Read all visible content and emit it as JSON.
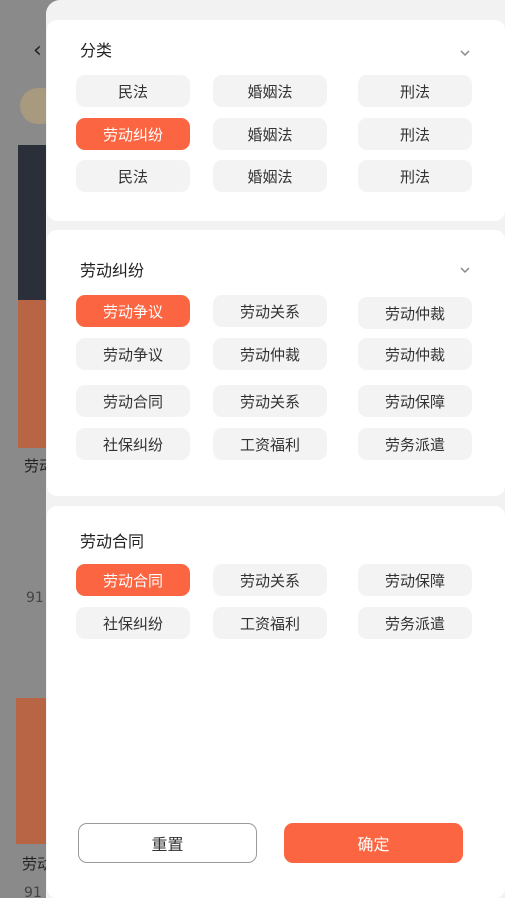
{
  "background": {
    "back_icon": "chevron-left-icon",
    "card_title_1": "劳动",
    "card_count_1": "91",
    "card_title_2": "劳动",
    "card_count_2": "91"
  },
  "colors": {
    "accent": "#fb6541",
    "chip_bg": "#f3f3f3"
  },
  "sections": [
    {
      "title": "分类",
      "chevron": "chevron-down-icon",
      "chips": [
        {
          "label": "民法",
          "active": false
        },
        {
          "label": "婚姻法",
          "active": false
        },
        {
          "label": "刑法",
          "active": false
        },
        {
          "label": "劳动纠纷",
          "active": true
        },
        {
          "label": "婚姻法",
          "active": false
        },
        {
          "label": "刑法",
          "active": false
        },
        {
          "label": "民法",
          "active": false
        },
        {
          "label": "婚姻法",
          "active": false
        },
        {
          "label": "刑法",
          "active": false
        }
      ]
    },
    {
      "title": "劳动纠纷",
      "chevron": "chevron-down-icon",
      "chips": [
        {
          "label": "劳动争议",
          "active": true
        },
        {
          "label": "劳动关系",
          "active": false
        },
        {
          "label": "劳动仲裁",
          "active": false
        },
        {
          "label": "劳动争议",
          "active": false
        },
        {
          "label": "劳动仲裁",
          "active": false
        },
        {
          "label": "劳动仲裁",
          "active": false
        },
        {
          "label": "劳动合同",
          "active": false
        },
        {
          "label": "劳动关系",
          "active": false
        },
        {
          "label": "劳动保障",
          "active": false
        },
        {
          "label": "社保纠纷",
          "active": false
        },
        {
          "label": "工资福利",
          "active": false
        },
        {
          "label": "劳务派遣",
          "active": false
        }
      ]
    },
    {
      "title": "劳动合同",
      "chips": [
        {
          "label": "劳动合同",
          "active": true
        },
        {
          "label": "劳动关系",
          "active": false
        },
        {
          "label": "劳动保障",
          "active": false
        },
        {
          "label": "社保纠纷",
          "active": false
        },
        {
          "label": "工资福利",
          "active": false
        },
        {
          "label": "劳务派遣",
          "active": false
        }
      ]
    }
  ],
  "footer": {
    "reset_label": "重置",
    "confirm_label": "确定"
  }
}
